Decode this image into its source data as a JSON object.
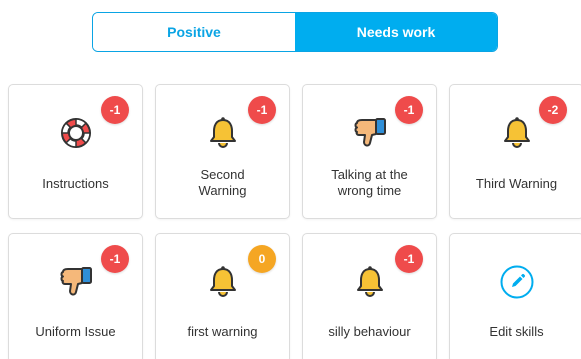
{
  "toggle": {
    "positive_label": "Positive",
    "needs_work_label": "Needs work",
    "selected": "Needs work"
  },
  "colors": {
    "accent": "#00adef",
    "badge_negative": "#ef4b4b",
    "badge_zero": "#f5a623",
    "bell": "#f6c235",
    "thumb": "#f5b87a",
    "cuff": "#2f8fd8"
  },
  "skills": [
    {
      "label": "Instructions",
      "icon": "lifebuoy-icon",
      "badge": "-1"
    },
    {
      "label": "Second\nWarning",
      "icon": "bell-icon",
      "badge": "-1"
    },
    {
      "label": "Talking at the\nwrong time",
      "icon": "thumbs-down-icon",
      "badge": "-1"
    },
    {
      "label": "Third Warning",
      "icon": "bell-icon",
      "badge": "-2"
    },
    {
      "label": "Uniform Issue",
      "icon": "thumbs-down-icon",
      "badge": "-1"
    },
    {
      "label": "first warning",
      "icon": "bell-icon",
      "badge": "0"
    },
    {
      "label": "silly behaviour",
      "icon": "bell-icon",
      "badge": "-1"
    },
    {
      "label": "Edit skills",
      "icon": "pencil-icon",
      "badge": ""
    }
  ]
}
